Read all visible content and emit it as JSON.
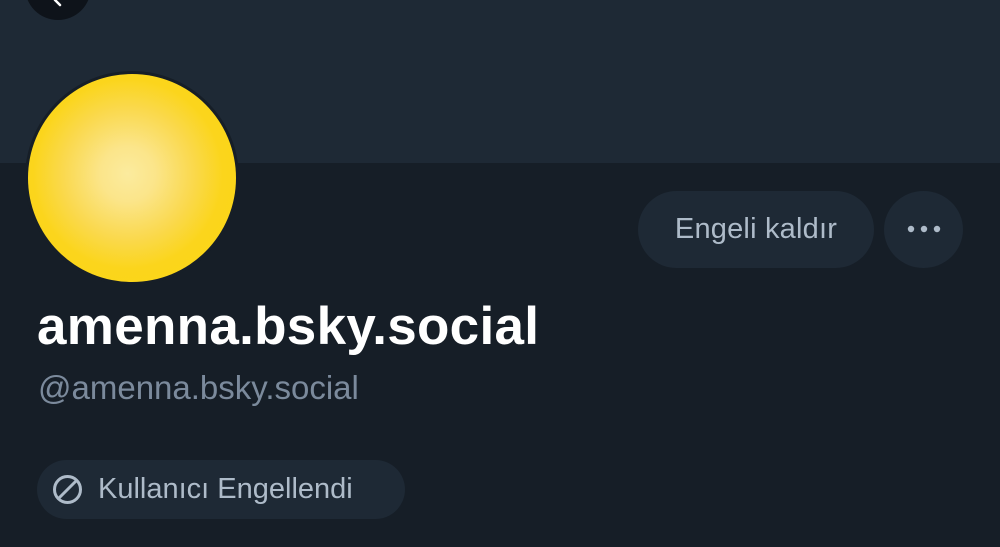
{
  "header": {
    "back_icon": "chevron-left-icon"
  },
  "profile": {
    "avatar_color": "#fcd712",
    "display_name": "amenna.bsky.social",
    "handle": "@amenna.bsky.social"
  },
  "actions": {
    "unblock_label": "Engeli kaldır",
    "more_icon": "ellipsis-icon"
  },
  "status": {
    "blocked_label": "Kullanıcı Engellendi",
    "icon": "block-icon"
  },
  "colors": {
    "background": "#161e27",
    "banner": "#1e2935",
    "button_bg": "#1e2935",
    "button_text": "#aebbc9",
    "handle_text": "#7b8a9c"
  }
}
